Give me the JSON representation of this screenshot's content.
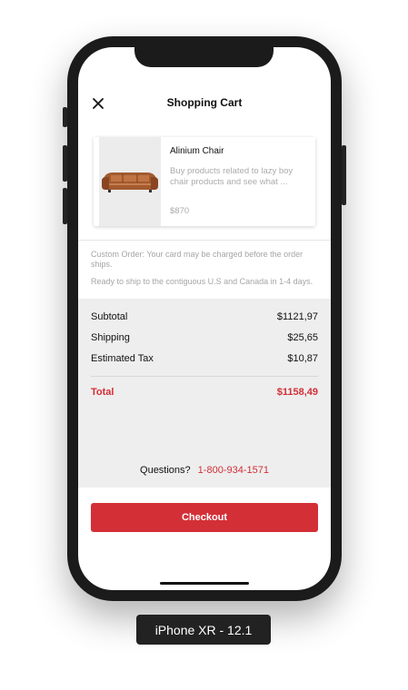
{
  "header": {
    "title": "Shopping Cart",
    "close_icon": "close-icon"
  },
  "cart_item": {
    "name": "Alinium Chair",
    "description": "Buy products related to lazy boy chair products and see what ...",
    "price": "$870",
    "image_icon": "sofa-image"
  },
  "notes": {
    "custom_order": "Custom Order: Your card may be charged before the order ships.",
    "shipping_info": "Ready to ship to the contiguous U.S and Canada in 1-4 days."
  },
  "summary": {
    "subtotal_label": "Subtotal",
    "subtotal_value": "$1121,97",
    "shipping_label": "Shipping",
    "shipping_value": "$25,65",
    "tax_label": "Estimated Tax",
    "tax_value": "$10,87",
    "total_label": "Total",
    "total_value": "$1158,49"
  },
  "support": {
    "question_label": "Questions?",
    "phone": "1-800-934-1571"
  },
  "checkout": {
    "label": "Checkout"
  },
  "device": {
    "label": "iPhone XR - 12.1"
  },
  "colors": {
    "accent": "#d32f37",
    "summary_background": "#eeeeee",
    "device_frame": "#1b1b1b"
  }
}
